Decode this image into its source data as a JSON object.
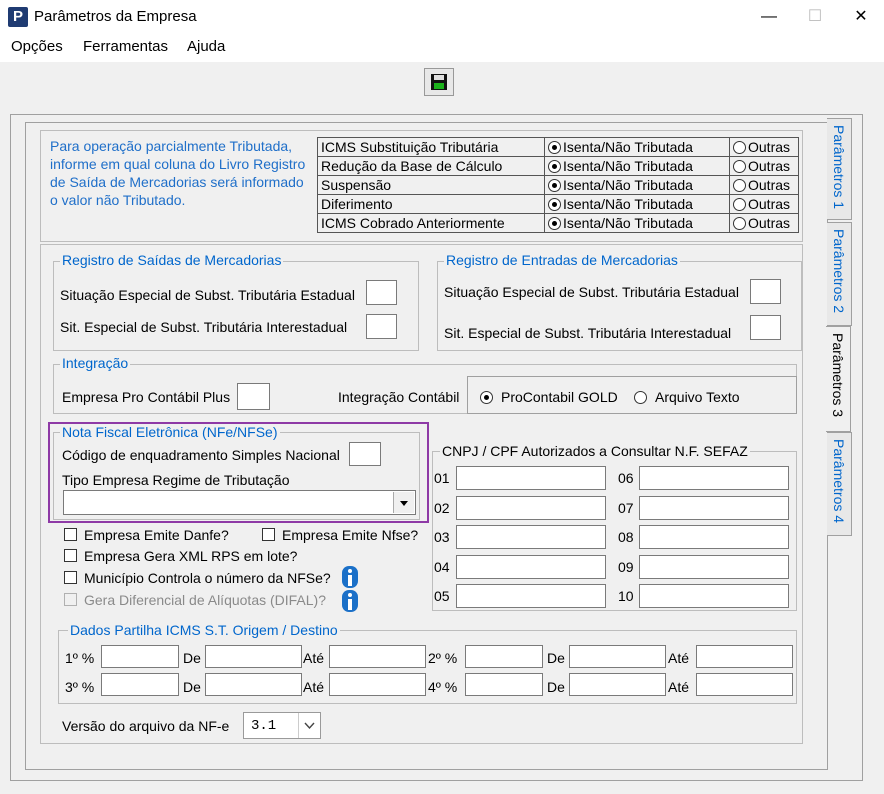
{
  "window": {
    "title": "Parâmetros da Empresa",
    "app_icon": "P",
    "minimize": "—",
    "maximize": "☐",
    "close": "✕"
  },
  "menu": [
    "Opções",
    "Ferramentas",
    "Ajuda"
  ],
  "tabs": [
    "Parâmetros 1",
    "Parâmetros 2",
    "Parâmetros 3",
    "Parâmetros 4"
  ],
  "active_tab": "Parâmetros 3",
  "note": "Para operação parcialmente Tributada, informe em qual coluna do Livro Registro de Saída de Mercadorias será informado o valor não Tributado.",
  "icms": {
    "rows": [
      "ICMS Substituição Tributária",
      "Redução da Base de Cálculo",
      "Suspensão",
      "Diferimento",
      "ICMS Cobrado Anteriormente"
    ],
    "option1": "Isenta/Não Tributada",
    "option2": "Outras",
    "selected": "Isenta/Não Tributada"
  },
  "saidas": {
    "title": "Registro de Saídas de Mercadorias",
    "estadual": "Situação Especial de Subst. Tributária Estadual",
    "interestadual": "Sit. Especial de Subst. Tributária Interestadual"
  },
  "entradas": {
    "title": "Registro de Entradas de Mercadorias",
    "estadual": "Situação Especial de Subst. Tributária Estadual",
    "interestadual": "Sit. Especial de Subst. Tributária Interestadual"
  },
  "integracao": {
    "title": "Integração",
    "empresa_label": "Empresa Pro Contábil Plus",
    "contabil_label": "Integração Contábil",
    "opt1": "ProContabil GOLD",
    "opt2": "Arquivo Texto",
    "selected": "ProContabil GOLD"
  },
  "nfe": {
    "title": "Nota Fiscal Eletrônica (NFe/NFSe)",
    "codigo_label": "Código de enquadramento Simples Nacional",
    "tipo_label": "Tipo Empresa Regime de Tributação",
    "tipo_value": ""
  },
  "checks": {
    "danfe": "Empresa Emite Danfe?",
    "nfse": "Empresa Emite Nfse?",
    "xml": "Empresa Gera XML RPS em lote?",
    "municipio": "Município Controla o número da NFSe?",
    "difal": "Gera Diferencial de Alíquotas (DIFAL)?"
  },
  "cnpj": {
    "title": "CNPJ / CPF Autorizados a Consultar N.F. SEFAZ",
    "labels": [
      "01",
      "02",
      "03",
      "04",
      "05",
      "06",
      "07",
      "08",
      "09",
      "10"
    ]
  },
  "partilha": {
    "title": "Dados Partilha ICMS S.T. Origem / Destino",
    "rows": [
      "1º %",
      "2º %",
      "3º %",
      "4º %"
    ],
    "de": "De",
    "ate": "Até"
  },
  "versao": {
    "label": "Versão do arquivo da NF-e",
    "value": "3.1"
  }
}
